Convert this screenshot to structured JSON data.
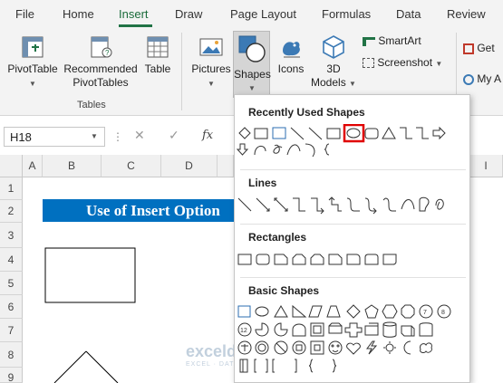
{
  "ribbon_tabs": [
    "File",
    "Home",
    "Insert",
    "Draw",
    "Page Layout",
    "Formulas",
    "Data",
    "Review"
  ],
  "active_tab": "Insert",
  "ribbon": {
    "pivottable": "PivotTable",
    "recommended_1": "Recommended",
    "recommended_2": "PivotTables",
    "table": "Table",
    "group_tables": "Tables",
    "pictures": "Pictures",
    "shapes": "Shapes",
    "icons": "Icons",
    "models_1": "3D",
    "models_2": "Models",
    "smartart": "SmartArt",
    "screenshot": "Screenshot",
    "get_addins": "Get",
    "my_addins": "My A"
  },
  "formula_bar": {
    "name_box": "H18",
    "fx": "fx"
  },
  "columns": [
    "A",
    "B",
    "C",
    "D",
    "I"
  ],
  "rows": [
    "1",
    "2",
    "3",
    "4",
    "5",
    "6",
    "7",
    "8",
    "9"
  ],
  "sheet_title": "Use of Insert Option",
  "shapes_menu": {
    "recent": "Recently Used Shapes",
    "lines": "Lines",
    "rectangles": "Rectangles",
    "basic": "Basic Shapes",
    "selected_shape": "Oval"
  },
  "watermark": {
    "name": "exceldemy",
    "tagline": "EXCEL · DATA · BI"
  },
  "colors": {
    "accent": "#217346",
    "title_fill": "#0070c0",
    "highlight": "#e00000"
  }
}
